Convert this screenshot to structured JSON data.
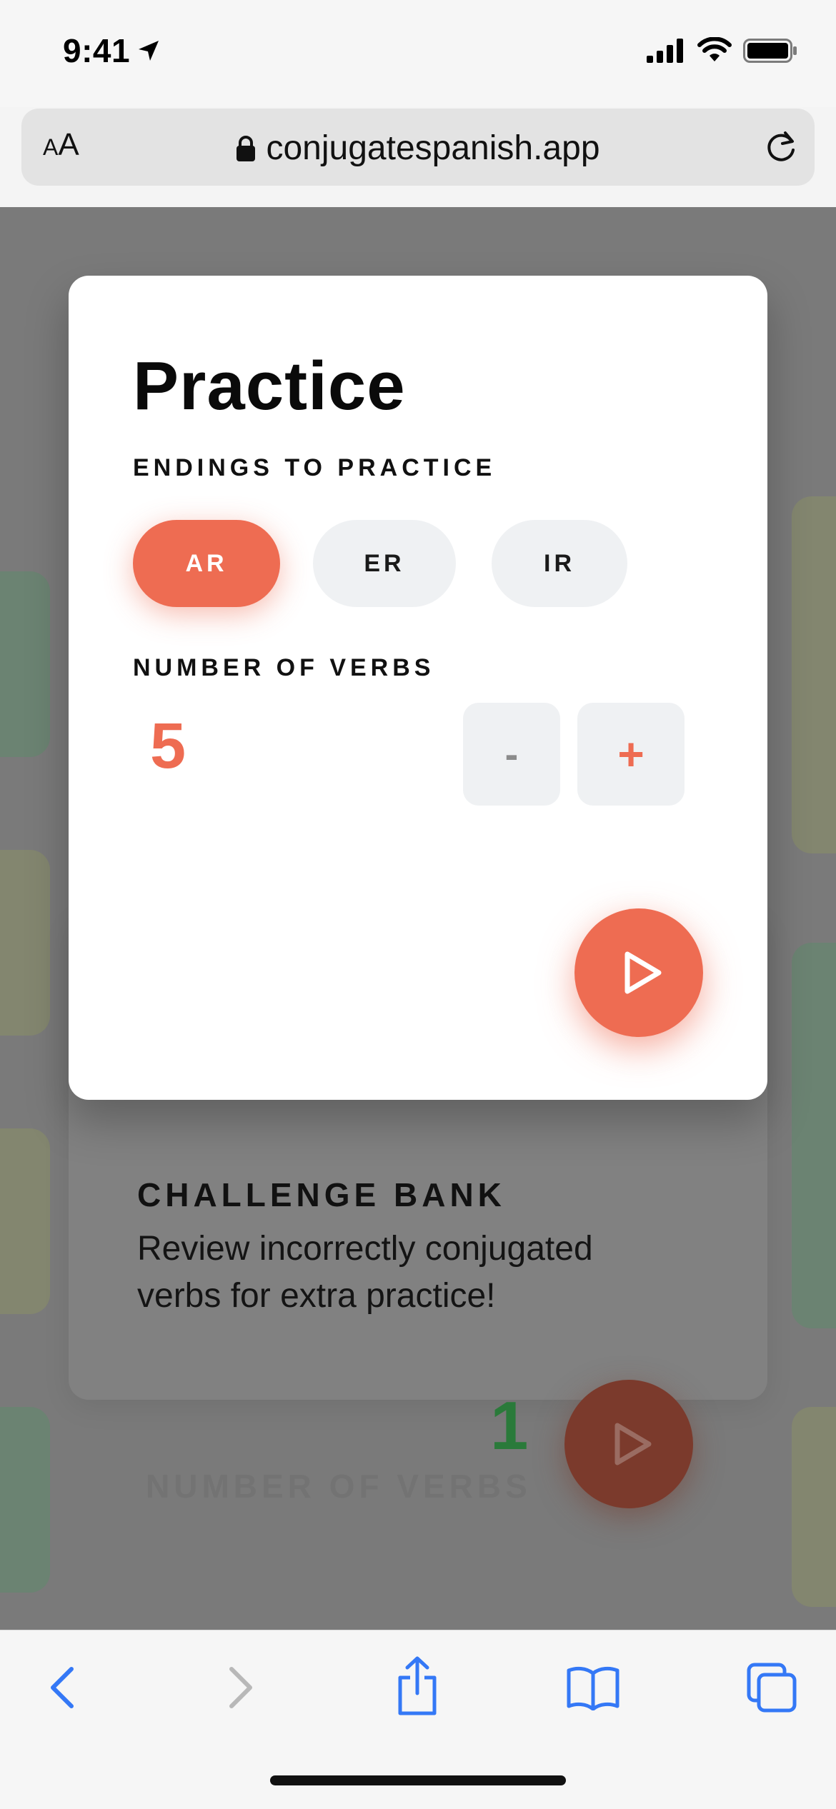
{
  "status_bar": {
    "time": "9:41"
  },
  "browser": {
    "aa_label_small": "A",
    "aa_label_large": "A",
    "url": "conjugatespanish.app"
  },
  "modal": {
    "title": "Practice",
    "endings_label": "ENDINGS TO PRACTICE",
    "endings": [
      {
        "label": "AR",
        "selected": true
      },
      {
        "label": "ER",
        "selected": false
      },
      {
        "label": "IR",
        "selected": false
      }
    ],
    "verbs_label": "NUMBER OF VERBS",
    "verb_count": "5",
    "minus_label": "-",
    "plus_label": "+"
  },
  "challenge_bank": {
    "title": "CHALLENGE BANK",
    "description": "Review incorrectly conjugated verbs for extra practice!",
    "count": "1",
    "count_label": "NUMBER OF VERBS"
  },
  "colors": {
    "accent": "#ee6c52",
    "chip_inactive": "#eff1f3",
    "safari_blue": "#3478f6",
    "count_green": "#2a7a3a"
  }
}
